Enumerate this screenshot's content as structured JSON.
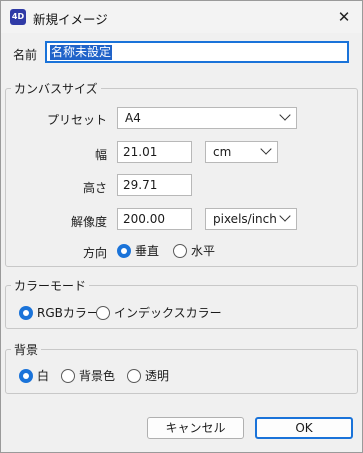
{
  "window": {
    "title": "新規イメージ",
    "app_icon_text": "4D",
    "close_glyph": "✕"
  },
  "name": {
    "label": "名前",
    "value": "名称未設定"
  },
  "canvas": {
    "legend": "カンバスサイズ",
    "preset": {
      "label": "プリセット",
      "value": "A4"
    },
    "width": {
      "label": "幅",
      "value": "21.01",
      "unit": "cm"
    },
    "height": {
      "label": "高さ",
      "value": "29.71"
    },
    "resolution": {
      "label": "解像度",
      "value": "200.00",
      "unit": "pixels/inch"
    },
    "orientation": {
      "label": "方向",
      "options": [
        {
          "label": "垂直",
          "selected": true
        },
        {
          "label": "水平",
          "selected": false
        }
      ]
    }
  },
  "color_mode": {
    "legend": "カラーモード",
    "options": [
      {
        "label": "RGBカラー",
        "selected": true
      },
      {
        "label": "インデックスカラー",
        "selected": false
      }
    ]
  },
  "background": {
    "legend": "背景",
    "options": [
      {
        "label": "白",
        "selected": true
      },
      {
        "label": "背景色",
        "selected": false
      },
      {
        "label": "透明",
        "selected": false
      }
    ]
  },
  "buttons": {
    "cancel": "キャンセル",
    "ok": "OK"
  },
  "colors": {
    "accent": "#1a73d9",
    "selection": "#2063c9"
  }
}
